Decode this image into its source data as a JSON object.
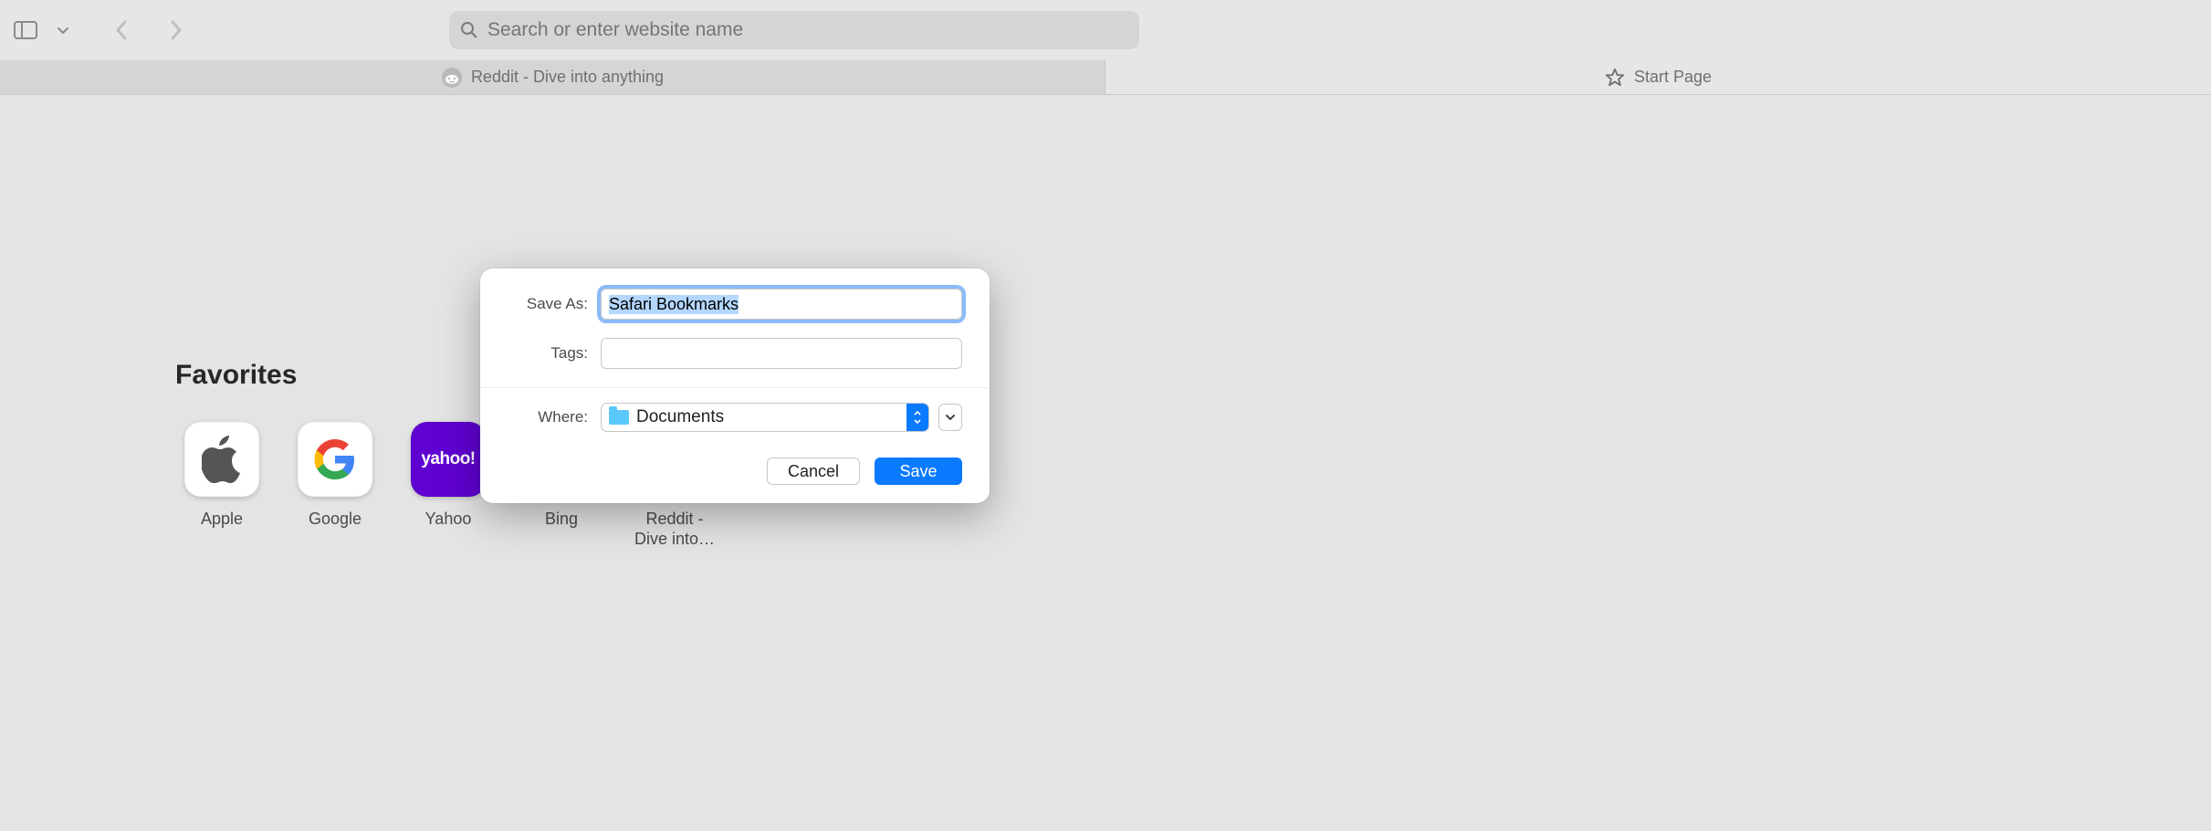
{
  "toolbar": {
    "address_placeholder": "Search or enter website name"
  },
  "tabs": [
    {
      "label": "Reddit - Dive into anything",
      "icon": "reddit",
      "active": true
    },
    {
      "label": "Start Page",
      "icon": "star",
      "active": false
    }
  ],
  "startPage": {
    "favorites_heading": "Favorites",
    "favorites": [
      {
        "label": "Apple",
        "bg": "#ffffff",
        "icon": "apple"
      },
      {
        "label": "Google",
        "bg": "#ffffff",
        "icon": "google"
      },
      {
        "label": "Yahoo",
        "bg": "#5f01d1",
        "icon": "yahoo"
      },
      {
        "label": "Bing",
        "bg": "#1e90ff",
        "icon": "bing"
      },
      {
        "label": "Reddit - Dive into…",
        "bg": "#ffffff",
        "icon": "reddit"
      }
    ]
  },
  "dialog": {
    "save_as_label": "Save As:",
    "save_as_value": "Safari Bookmarks",
    "tags_label": "Tags:",
    "tags_value": "",
    "where_label": "Where:",
    "where_value": "Documents",
    "cancel_label": "Cancel",
    "save_label": "Save"
  }
}
